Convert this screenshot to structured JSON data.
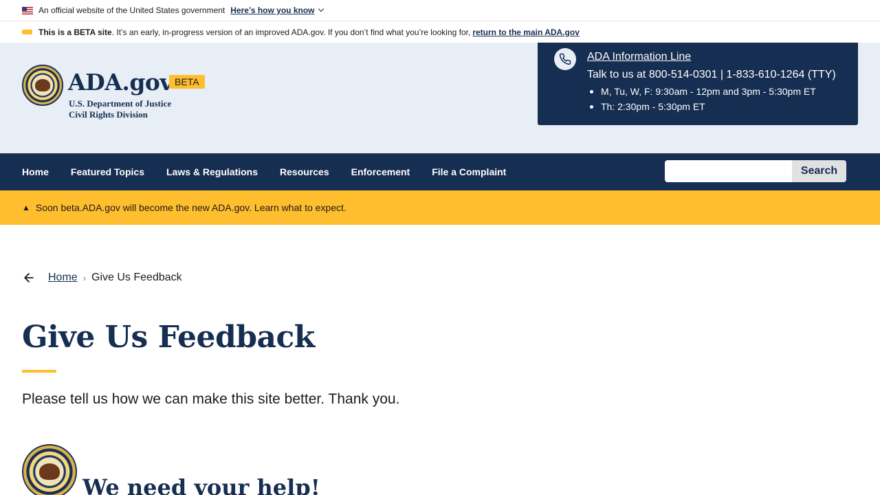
{
  "gov_banner": {
    "text": "An official website of the United States government",
    "link": "Here’s how you know"
  },
  "beta_banner": {
    "bold": "This is a BETA site",
    "text": ". It’s an early, in-progress version of an improved ADA.gov. If you don’t find what you’re looking for,",
    "link": "return to the main ADA.gov"
  },
  "header": {
    "site_name": "ADA.gov",
    "badge": "BETA",
    "dept_line1": "U.S. Department of Justice",
    "dept_line2": "Civil Rights Division",
    "infoline": {
      "title": "ADA Information Line",
      "talk": "Talk to us at 800-514-0301 | 1-833-610-1264 (TTY)",
      "hours": [
        "M, Tu, W, F: 9:30am - 12pm and 3pm - 5:30pm ET",
        "Th: 2:30pm - 5:30pm ET"
      ]
    }
  },
  "nav": {
    "items": [
      "Home",
      "Featured Topics",
      "Laws & Regulations",
      "Resources",
      "Enforcement",
      "File a Complaint"
    ],
    "search_placeholder": "",
    "search_button": "Search"
  },
  "alert": {
    "text": "Soon beta.ADA.gov will become the new ADA.gov. Learn what to expect."
  },
  "breadcrumb": {
    "home": "Home",
    "separator": "›",
    "current": "Give Us Feedback"
  },
  "main": {
    "title": "Give Us Feedback",
    "lead": "Please tell us how we can make this site better. Thank you.",
    "section_heading": "We need your help!"
  },
  "colors": {
    "primary": "#162e51",
    "accent": "#ffbe2e",
    "header_bg": "#e8eef6"
  }
}
